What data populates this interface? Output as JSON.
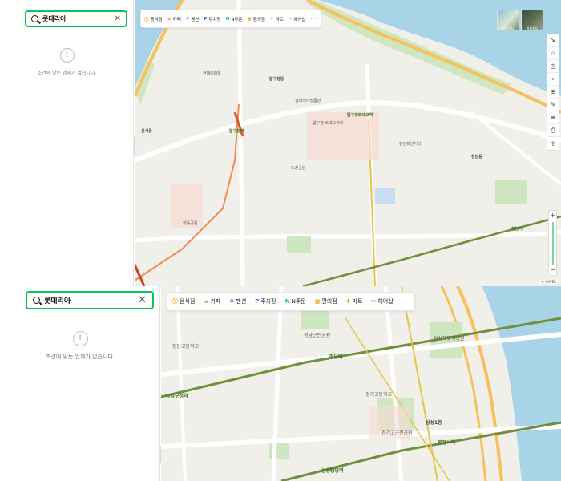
{
  "search": {
    "value": "롯데리아"
  },
  "empty_message": "조건에 맞는 업체가 없습니다.",
  "categories": [
    {
      "label": "음식점",
      "icon": "fork-knife-icon",
      "glyph": "ⓨ",
      "color": "#e8a32c"
    },
    {
      "label": "카페",
      "icon": "cup-icon",
      "glyph": "☕",
      "color": "#c75c2a"
    },
    {
      "label": "펜션",
      "icon": "bed-icon",
      "glyph": "≘",
      "color": "#8e6cc9"
    },
    {
      "label": "주차장",
      "icon": "parking-icon",
      "glyph": "P",
      "color": "#2e6bd6"
    },
    {
      "label": "N주문",
      "icon": "n-order-icon",
      "glyph": "N",
      "color": "#03c75a"
    },
    {
      "label": "편의점",
      "icon": "store-icon",
      "glyph": "▦",
      "color": "#e0a100"
    },
    {
      "label": "마트",
      "icon": "cart-icon",
      "glyph": "✚",
      "color": "#e0a100"
    },
    {
      "label": "헤어샵",
      "icon": "scissors-icon",
      "glyph": "✂",
      "color": "#e44d7b"
    }
  ],
  "more_label": "···",
  "map1": {
    "labels": {
      "apgujeong_dong": "압구정동",
      "apgujeong_station": "압구정로데오역",
      "apgujeong_st": "압구정역",
      "cheongdam": "청담동",
      "sinsa": "신사동",
      "rodeo_street": "압구정 로데오거리",
      "cheongdam_fashion": "청담패션거리",
      "dosan_park": "도산공원",
      "cheongdam_station": "청담역",
      "galleria": "갤러리아명품관",
      "hyundai_apt": "현대아파트",
      "hakdong_park": "학동공원"
    }
  },
  "map2": {
    "labels": {
      "cheongdam_park": "청담근린공원",
      "samsung_park": "삼성해맞이공원",
      "cheongdam_station": "청담역",
      "gangnamgu_office": "강남구청역",
      "samseong1dong": "삼성1동",
      "bongeunsa": "봉은사역",
      "gyeonggi_highschool": "경기고등학교",
      "cheongdam_highschool": "청담고등학교",
      "samsung_station": "삼성중앙역",
      "kyunggi_park": "경기고근린공원"
    }
  },
  "tools": [
    "⇲",
    "☆",
    "◷",
    "⌖",
    "⊞",
    "✎",
    "≡",
    "⎙",
    "⇪"
  ],
  "thumbs": [
    "일반지도",
    "위성지도"
  ],
  "scale_text": "© NAVER"
}
